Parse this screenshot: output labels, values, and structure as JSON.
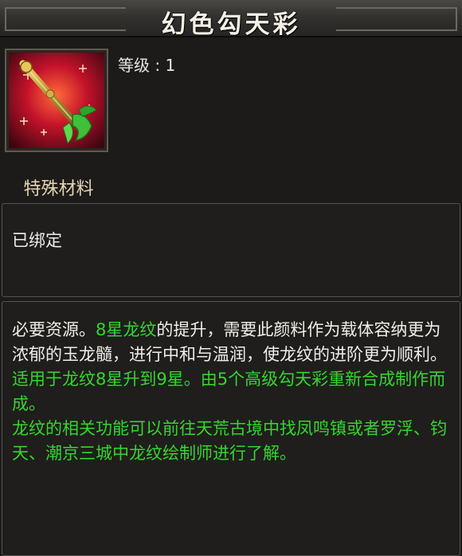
{
  "title": "幻色勾天彩",
  "level_label": "等级 : 1",
  "item_type": "特殊材料",
  "bind_status": "已绑定",
  "description": {
    "p1_a": "必要资源。",
    "p1_b": "8星龙纹",
    "p1_c": "的提升，需要此颜料作为载体容纳更为浓郁的玉龙髓，进行中和与温润，使龙纹的进阶更为顺利。",
    "p2": "适用于龙纹8星升到9星。由5个高级勾天彩重新合成制作而成。",
    "p3": "龙纹的相关功能可以前往天荒古境中找凤鸣镇或者罗浮、钧天、潮京三城中龙纹绘制师进行了解。"
  },
  "colors": {
    "highlight_green": "#35d52f",
    "text": "#f0eee8",
    "title": "#f4f0e6"
  },
  "icon": "jade-dragon-scepter-icon"
}
